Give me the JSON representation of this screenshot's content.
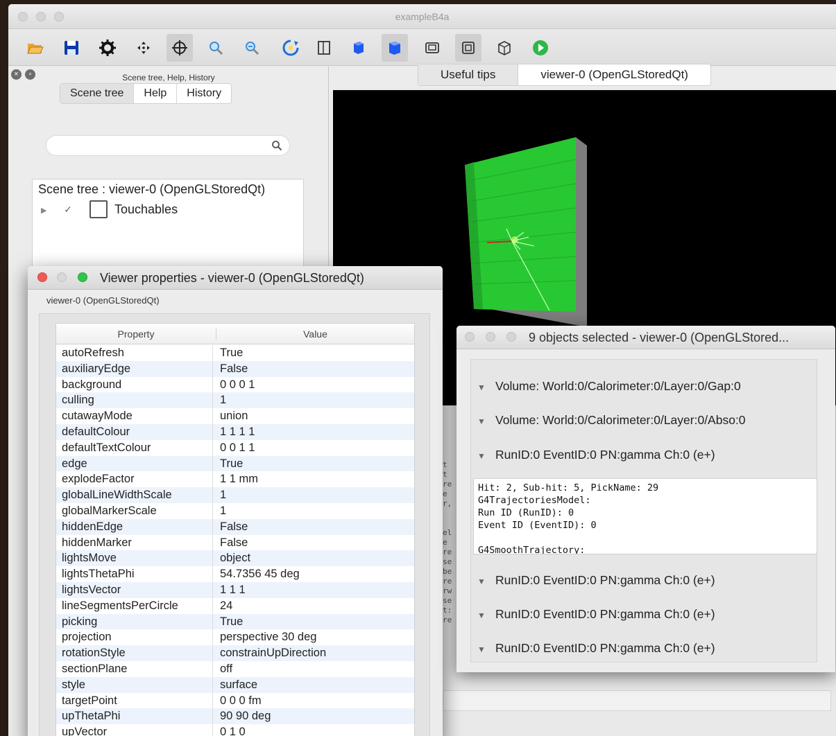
{
  "window": {
    "title": "exampleB4a"
  },
  "toolbar": {
    "buttons": [
      {
        "name": "open-icon",
        "color": "#d9892a"
      },
      {
        "name": "save-icon",
        "color": "#0a3ca8"
      },
      {
        "name": "settings-gear-icon",
        "color": "#111111"
      },
      {
        "name": "move-icon",
        "color": "#222222"
      },
      {
        "name": "pick-crosshair-icon",
        "color": "#222222"
      },
      {
        "name": "zoom-in-icon",
        "color": "#3a8fd8"
      },
      {
        "name": "zoom-out-icon",
        "color": "#3a8fd8"
      },
      {
        "name": "rotate-icon",
        "color": "#1e6fd9"
      },
      {
        "name": "hidden-line-icon",
        "color": "#333333"
      },
      {
        "name": "solid-icon",
        "color": "#1e5bf0"
      },
      {
        "name": "solid-selected-icon",
        "color": "#1e5bf0"
      },
      {
        "name": "perspective-icon",
        "color": "#333333"
      },
      {
        "name": "ortho-icon",
        "color": "#333333"
      },
      {
        "name": "wireframe-icon",
        "color": "#333333"
      },
      {
        "name": "run-beam-icon",
        "color": "#2cb84a"
      }
    ]
  },
  "scene_dock": {
    "title": "Scene tree, Help, History",
    "tabs": [
      "Scene tree",
      "Help",
      "History"
    ],
    "search_placeholder": "",
    "tree_heading": "Scene tree : viewer-0 (OpenGLStoredQt)",
    "tree_item": "Touchables"
  },
  "viewer_tabs": [
    "Useful tips",
    "viewer-0 (OpenGLStoredQt)"
  ],
  "properties_dialog": {
    "title": "Viewer properties - viewer-0 (OpenGLStoredQt)",
    "subtitle": "viewer-0 (OpenGLStoredQt)",
    "columns": [
      "Property",
      "Value"
    ],
    "rows": [
      [
        "autoRefresh",
        "True"
      ],
      [
        "auxiliaryEdge",
        "False"
      ],
      [
        "background",
        "0 0 0 1"
      ],
      [
        "culling",
        "1"
      ],
      [
        "cutawayMode",
        "union"
      ],
      [
        "defaultColour",
        "1 1 1 1"
      ],
      [
        "defaultTextColour",
        "0 0 1 1"
      ],
      [
        "edge",
        "True"
      ],
      [
        "explodeFactor",
        "1 1 mm"
      ],
      [
        "globalLineWidthScale",
        "1"
      ],
      [
        "globalMarkerScale",
        "1"
      ],
      [
        "hiddenEdge",
        "False"
      ],
      [
        "hiddenMarker",
        "False"
      ],
      [
        "lightsMove",
        "object"
      ],
      [
        "lightsThetaPhi",
        "54.7356 45 deg"
      ],
      [
        "lightsVector",
        "1 1 1"
      ],
      [
        "lineSegmentsPerCircle",
        "24"
      ],
      [
        "picking",
        "True"
      ],
      [
        "projection",
        "perspective 30 deg"
      ],
      [
        "rotationStyle",
        "constrainUpDirection"
      ],
      [
        "sectionPlane",
        "off"
      ],
      [
        "style",
        "surface"
      ],
      [
        "targetPoint",
        "0 0 0 fm"
      ],
      [
        "upThetaPhi",
        "90 90 deg"
      ],
      [
        "upVector",
        "0 1 0"
      ]
    ]
  },
  "pick_dialog": {
    "title": "9 objects selected - viewer-0 (OpenGLStored...",
    "items_top": [
      "Volume: World:0/Calorimeter:0/Layer:0/Gap:0",
      "Volume: World:0/Calorimeter:0/Layer:0/Abso:0",
      "RunID:0 EventID:0 PN:gamma Ch:0 (e+)"
    ],
    "detail_text": "Hit: 2, Sub-hit: 5, PickName: 29\nG4TrajectoriesModel:\nRun ID (RunID): 0\nEvent ID (EventID): 0\n\nG4SmoothTrajectory:",
    "items_bottom": [
      "RunID:0 EventID:0 PN:gamma Ch:0 (e+)",
      "RunID:0 EventID:0 PN:gamma Ch:0 (e+)",
      "RunID:0 EventID:0 PN:gamma Ch:0 (e+)"
    ]
  },
  "background_console": {
    "gutter": "t\nt\nre\ne\nr,\n\n\nel\ne\nre\nse\nbe\nre\nrw\nse\nt:\nre"
  }
}
